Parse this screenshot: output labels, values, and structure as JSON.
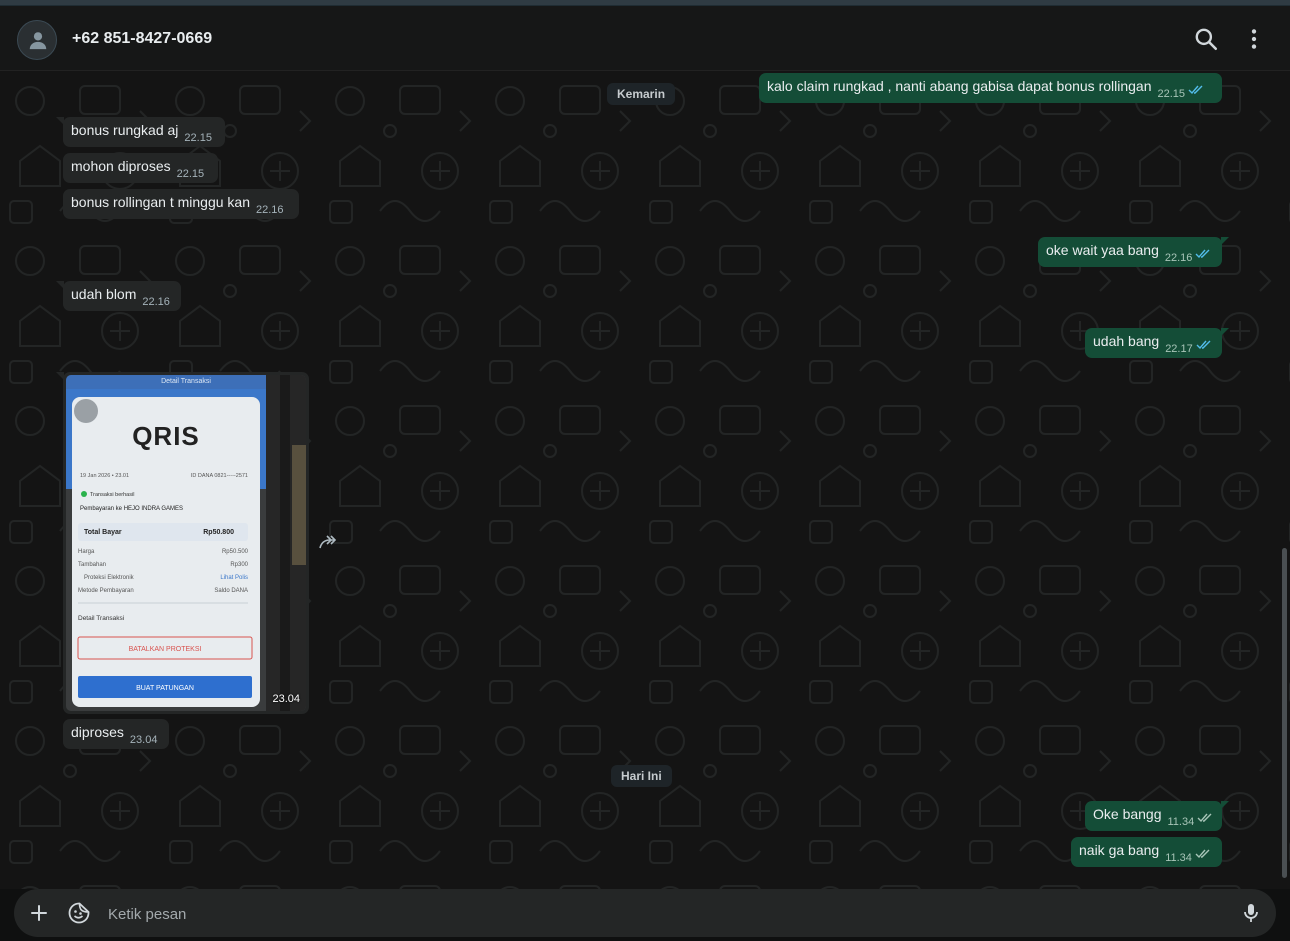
{
  "header": {
    "contact_name": "+62 851-8427-0669",
    "icons": [
      "person-icon",
      "search-icon",
      "kebab-menu-icon"
    ]
  },
  "chat": {
    "date_dividers": {
      "yesterday": "Kemarin",
      "today": "Hari Ini"
    },
    "messages": [
      {
        "dir": "out",
        "text": "kalo claim rungkad , nanti abang gabisa dapat bonus rollingan",
        "time": "22.15",
        "status": "read"
      },
      {
        "dir": "in",
        "text": "bonus rungkad aj",
        "time": "22.15"
      },
      {
        "dir": "in",
        "text": "mohon diproses",
        "time": "22.15"
      },
      {
        "dir": "in",
        "text": "bonus rollingan t minggu kan",
        "time": "22.16"
      },
      {
        "dir": "out",
        "text": "oke wait yaa bang",
        "time": "22.16",
        "status": "read"
      },
      {
        "dir": "in",
        "text": "udah blom",
        "time": "22.16"
      },
      {
        "dir": "out",
        "text": "udah bang",
        "time": "22.17",
        "status": "read"
      },
      {
        "dir": "in",
        "type": "image",
        "time": "23.04"
      },
      {
        "dir": "in",
        "text": "diproses",
        "time": "23.04"
      },
      {
        "dir": "out",
        "text": "Oke bangg",
        "time": "11.34",
        "status": "delivered"
      },
      {
        "dir": "out",
        "text": "naik ga bang",
        "time": "11.34",
        "status": "delivered"
      }
    ],
    "image_content": {
      "title": "Detail Transaksi",
      "logo": "QRIS",
      "date": "19 Jan 2026 • 23.01",
      "id_dana": "ID DANA 0821-----2571",
      "status": "Transaksi berhasil",
      "merchant": "Pembayaran ke HEJO INDRA GAMES",
      "total_label": "Total Bayar",
      "total_value": "Rp50.800",
      "rows": [
        {
          "label": "Harga",
          "value": "Rp50.500"
        },
        {
          "label": "Tambahan",
          "value": "Rp300"
        },
        {
          "label": "Proteksi Elektronik",
          "value": "Lihat Polis"
        },
        {
          "label": "Metode Pembayaran",
          "value": "Saldo DANA"
        }
      ],
      "detail_label": "Detail Transaksi",
      "cancel_btn": "BATALKAN PROTEKSI",
      "share_btn": "BUAT PATUNGAN"
    }
  },
  "composer": {
    "placeholder": "Ketik pesan",
    "icons": [
      "plus-icon",
      "sticker-icon",
      "microphone-icon"
    ]
  },
  "colors": {
    "header_bg": "#161717",
    "chat_bg": "#141414",
    "bubble_in": "#242626",
    "bubble_out": "#144d37",
    "read_tick": "#53bdeb",
    "text": "#e9edef"
  }
}
